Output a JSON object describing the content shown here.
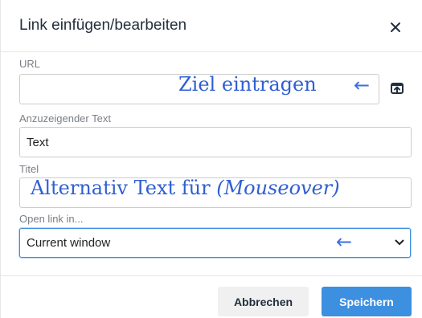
{
  "dialog": {
    "title": "Link einfügen/bearbeiten",
    "close_icon": "close-icon"
  },
  "url_field": {
    "label": "URL",
    "value": "",
    "annotation": "Ziel eintragen",
    "annotation_arrow": "←",
    "upload_icon": "upload-icon"
  },
  "text_field": {
    "label": "Anzuzeigender Text",
    "value": "Text"
  },
  "title_field": {
    "label": "Titel",
    "annotation_plain": "Alternativ Text für ",
    "annotation_italic": "(Mouseover)"
  },
  "open_link": {
    "label": "Open link in...",
    "selected": "Current window",
    "annotation_arrow": "←",
    "chevron_icon": "chevron-down-icon"
  },
  "footer": {
    "cancel_label": "Abbrechen",
    "save_label": "Speichern"
  },
  "colors": {
    "accent": "#3d8fe0",
    "annotation": "#2f5fd1",
    "title_text": "#222f3e",
    "label_text": "#7a7f85"
  }
}
